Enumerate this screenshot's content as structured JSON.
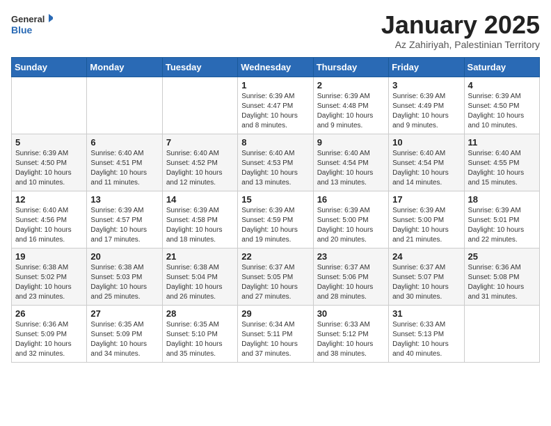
{
  "logo": {
    "general": "General",
    "blue": "Blue"
  },
  "title": "January 2025",
  "subtitle": "Az Zahiriyah, Palestinian Territory",
  "weekdays": [
    "Sunday",
    "Monday",
    "Tuesday",
    "Wednesday",
    "Thursday",
    "Friday",
    "Saturday"
  ],
  "weeks": [
    [
      {
        "day": "",
        "sunrise": "",
        "sunset": "",
        "daylight": ""
      },
      {
        "day": "",
        "sunrise": "",
        "sunset": "",
        "daylight": ""
      },
      {
        "day": "",
        "sunrise": "",
        "sunset": "",
        "daylight": ""
      },
      {
        "day": "1",
        "sunrise": "Sunrise: 6:39 AM",
        "sunset": "Sunset: 4:47 PM",
        "daylight": "Daylight: 10 hours and 8 minutes."
      },
      {
        "day": "2",
        "sunrise": "Sunrise: 6:39 AM",
        "sunset": "Sunset: 4:48 PM",
        "daylight": "Daylight: 10 hours and 9 minutes."
      },
      {
        "day": "3",
        "sunrise": "Sunrise: 6:39 AM",
        "sunset": "Sunset: 4:49 PM",
        "daylight": "Daylight: 10 hours and 9 minutes."
      },
      {
        "day": "4",
        "sunrise": "Sunrise: 6:39 AM",
        "sunset": "Sunset: 4:50 PM",
        "daylight": "Daylight: 10 hours and 10 minutes."
      }
    ],
    [
      {
        "day": "5",
        "sunrise": "Sunrise: 6:39 AM",
        "sunset": "Sunset: 4:50 PM",
        "daylight": "Daylight: 10 hours and 10 minutes."
      },
      {
        "day": "6",
        "sunrise": "Sunrise: 6:40 AM",
        "sunset": "Sunset: 4:51 PM",
        "daylight": "Daylight: 10 hours and 11 minutes."
      },
      {
        "day": "7",
        "sunrise": "Sunrise: 6:40 AM",
        "sunset": "Sunset: 4:52 PM",
        "daylight": "Daylight: 10 hours and 12 minutes."
      },
      {
        "day": "8",
        "sunrise": "Sunrise: 6:40 AM",
        "sunset": "Sunset: 4:53 PM",
        "daylight": "Daylight: 10 hours and 13 minutes."
      },
      {
        "day": "9",
        "sunrise": "Sunrise: 6:40 AM",
        "sunset": "Sunset: 4:54 PM",
        "daylight": "Daylight: 10 hours and 13 minutes."
      },
      {
        "day": "10",
        "sunrise": "Sunrise: 6:40 AM",
        "sunset": "Sunset: 4:54 PM",
        "daylight": "Daylight: 10 hours and 14 minutes."
      },
      {
        "day": "11",
        "sunrise": "Sunrise: 6:40 AM",
        "sunset": "Sunset: 4:55 PM",
        "daylight": "Daylight: 10 hours and 15 minutes."
      }
    ],
    [
      {
        "day": "12",
        "sunrise": "Sunrise: 6:40 AM",
        "sunset": "Sunset: 4:56 PM",
        "daylight": "Daylight: 10 hours and 16 minutes."
      },
      {
        "day": "13",
        "sunrise": "Sunrise: 6:39 AM",
        "sunset": "Sunset: 4:57 PM",
        "daylight": "Daylight: 10 hours and 17 minutes."
      },
      {
        "day": "14",
        "sunrise": "Sunrise: 6:39 AM",
        "sunset": "Sunset: 4:58 PM",
        "daylight": "Daylight: 10 hours and 18 minutes."
      },
      {
        "day": "15",
        "sunrise": "Sunrise: 6:39 AM",
        "sunset": "Sunset: 4:59 PM",
        "daylight": "Daylight: 10 hours and 19 minutes."
      },
      {
        "day": "16",
        "sunrise": "Sunrise: 6:39 AM",
        "sunset": "Sunset: 5:00 PM",
        "daylight": "Daylight: 10 hours and 20 minutes."
      },
      {
        "day": "17",
        "sunrise": "Sunrise: 6:39 AM",
        "sunset": "Sunset: 5:00 PM",
        "daylight": "Daylight: 10 hours and 21 minutes."
      },
      {
        "day": "18",
        "sunrise": "Sunrise: 6:39 AM",
        "sunset": "Sunset: 5:01 PM",
        "daylight": "Daylight: 10 hours and 22 minutes."
      }
    ],
    [
      {
        "day": "19",
        "sunrise": "Sunrise: 6:38 AM",
        "sunset": "Sunset: 5:02 PM",
        "daylight": "Daylight: 10 hours and 23 minutes."
      },
      {
        "day": "20",
        "sunrise": "Sunrise: 6:38 AM",
        "sunset": "Sunset: 5:03 PM",
        "daylight": "Daylight: 10 hours and 25 minutes."
      },
      {
        "day": "21",
        "sunrise": "Sunrise: 6:38 AM",
        "sunset": "Sunset: 5:04 PM",
        "daylight": "Daylight: 10 hours and 26 minutes."
      },
      {
        "day": "22",
        "sunrise": "Sunrise: 6:37 AM",
        "sunset": "Sunset: 5:05 PM",
        "daylight": "Daylight: 10 hours and 27 minutes."
      },
      {
        "day": "23",
        "sunrise": "Sunrise: 6:37 AM",
        "sunset": "Sunset: 5:06 PM",
        "daylight": "Daylight: 10 hours and 28 minutes."
      },
      {
        "day": "24",
        "sunrise": "Sunrise: 6:37 AM",
        "sunset": "Sunset: 5:07 PM",
        "daylight": "Daylight: 10 hours and 30 minutes."
      },
      {
        "day": "25",
        "sunrise": "Sunrise: 6:36 AM",
        "sunset": "Sunset: 5:08 PM",
        "daylight": "Daylight: 10 hours and 31 minutes."
      }
    ],
    [
      {
        "day": "26",
        "sunrise": "Sunrise: 6:36 AM",
        "sunset": "Sunset: 5:09 PM",
        "daylight": "Daylight: 10 hours and 32 minutes."
      },
      {
        "day": "27",
        "sunrise": "Sunrise: 6:35 AM",
        "sunset": "Sunset: 5:09 PM",
        "daylight": "Daylight: 10 hours and 34 minutes."
      },
      {
        "day": "28",
        "sunrise": "Sunrise: 6:35 AM",
        "sunset": "Sunset: 5:10 PM",
        "daylight": "Daylight: 10 hours and 35 minutes."
      },
      {
        "day": "29",
        "sunrise": "Sunrise: 6:34 AM",
        "sunset": "Sunset: 5:11 PM",
        "daylight": "Daylight: 10 hours and 37 minutes."
      },
      {
        "day": "30",
        "sunrise": "Sunrise: 6:33 AM",
        "sunset": "Sunset: 5:12 PM",
        "daylight": "Daylight: 10 hours and 38 minutes."
      },
      {
        "day": "31",
        "sunrise": "Sunrise: 6:33 AM",
        "sunset": "Sunset: 5:13 PM",
        "daylight": "Daylight: 10 hours and 40 minutes."
      },
      {
        "day": "",
        "sunrise": "",
        "sunset": "",
        "daylight": ""
      }
    ]
  ]
}
